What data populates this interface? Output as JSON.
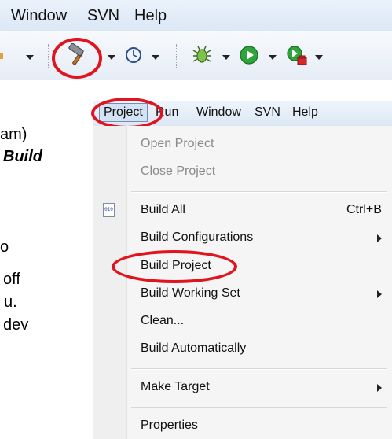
{
  "top_menu": {
    "window": "Window",
    "svn": "SVN",
    "help": "Help"
  },
  "toolbar": {
    "icons": [
      "hammer-icon",
      "clock-refresh-icon",
      "bug-icon",
      "run-icon",
      "external-tool-icon"
    ],
    "highlight_color": "#e0141e"
  },
  "body_text": {
    "line1": "am)",
    "line2": "Build",
    "line3": "o",
    "line4": "off",
    "line5": "u.",
    "line6": "dev"
  },
  "menu_bar": {
    "project": "Project",
    "run": "Run",
    "window": "Window",
    "svn": "SVN",
    "help": "Help"
  },
  "project_menu": {
    "open_project": "Open Project",
    "close_project": "Close Project",
    "build_all": "Build All",
    "build_all_shortcut": "Ctrl+B",
    "build_all_icon_text": "010",
    "build_configurations": "Build Configurations",
    "build_project": "Build Project",
    "build_working_set": "Build Working Set",
    "clean": "Clean...",
    "build_automatically": "Build Automatically",
    "make_target": "Make Target",
    "properties": "Properties"
  }
}
